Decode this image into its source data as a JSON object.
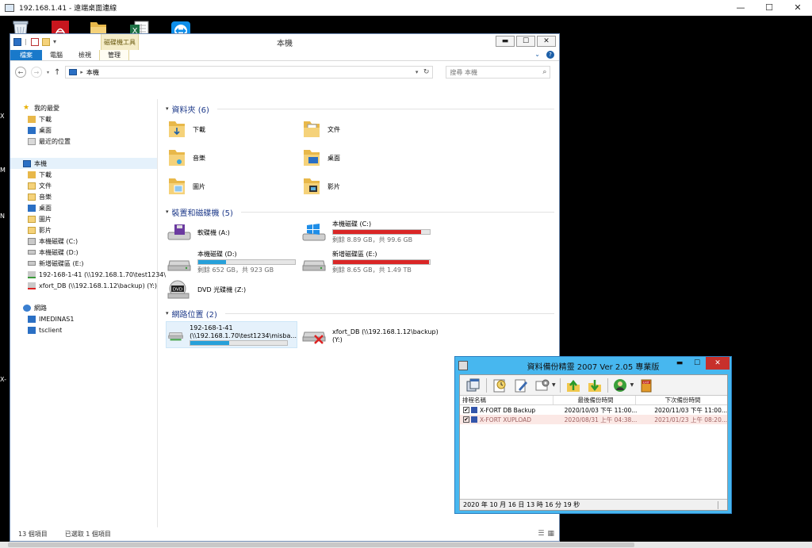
{
  "rdp": {
    "title": "192.168.1.41 - 遠端桌面連線",
    "min": "—",
    "max": "☐",
    "close": "✕"
  },
  "desktop": {
    "icons": [
      {
        "label": "資源回收筒",
        "icon": "recycle-bin-icon"
      },
      {
        "label": "Acrobat",
        "icon": "acrobat-icon"
      },
      {
        "label": "資料夾",
        "icon": "folder-icon"
      },
      {
        "label": "Excel",
        "icon": "excel-icon"
      },
      {
        "label": "TeamViewer",
        "icon": "teamviewer-icon"
      }
    ],
    "left_letters": [
      "X",
      "M",
      "N",
      "X-"
    ]
  },
  "explorer": {
    "title": "本機",
    "context_tab": "磁碟機工具",
    "ribbon_tabs": [
      "檔案",
      "電腦",
      "檢視",
      "管理"
    ],
    "address": "本機",
    "search_placeholder": "搜尋 本機",
    "nav": {
      "favorites_header": "我的最愛",
      "favorites": [
        "下載",
        "桌面",
        "最近的位置"
      ],
      "pc_header": "本機",
      "pc_items": [
        "下載",
        "文件",
        "音樂",
        "桌面",
        "圖片",
        "影片",
        "本機磁碟 (C:)",
        "本機磁碟 (D:)",
        "新增磁碟區 (E:)",
        "192-168-1-41 (\\\\192.168.1.70\\test1234\\",
        "xfort_DB (\\\\192.168.1.12\\backup) (Y:)"
      ],
      "network_header": "網路",
      "network_items": [
        "IMEDINAS1",
        "tsclient"
      ]
    },
    "groups": {
      "folders_header": "資料夾 (6)",
      "folders": [
        "下載",
        "文件",
        "音樂",
        "桌面",
        "圖片",
        "影片"
      ],
      "drives_header": "裝置和磁碟機 (5)",
      "drives": [
        {
          "name": "軟碟機 (A:)",
          "detail": "",
          "fill": 0,
          "color": ""
        },
        {
          "name": "本機磁碟 (C:)",
          "detail": "剩餘 8.89 GB，共 99.6 GB",
          "fill": 0.91,
          "color": "#da2626"
        },
        {
          "name": "本機磁碟 (D:)",
          "detail": "剩餘 652 GB，共 923 GB",
          "fill": 0.29,
          "color": "#26a0da"
        },
        {
          "name": "新增磁碟區 (E:)",
          "detail": "剩餘 8.65 GB，共 1.49 TB",
          "fill": 0.99,
          "color": "#da2626"
        },
        {
          "name": "DVD 光碟機 (Z:)",
          "detail": "",
          "fill": 0,
          "color": ""
        }
      ],
      "network_header": "網路位置 (2)",
      "network": [
        {
          "line1": "192-168-1-41",
          "line2": "(\\\\192.168.1.70\\test1234\\misba...",
          "fill": 0.4,
          "color": "#26a0da"
        },
        {
          "line1": "xfort_DB (\\\\192.168.1.12\\backup)",
          "line2": "(Y:)"
        }
      ]
    },
    "status": {
      "count": "13 個項目",
      "selected": "已選取 1 個項目"
    }
  },
  "backup_app": {
    "title": "資料備份精靈 2007 Ver 2.05 專業版",
    "columns": [
      "排程名稱",
      "最後備份時間",
      "下次備份時間"
    ],
    "rows": [
      {
        "name": "X-FORT DB Backup",
        "last": "2020/10/03 下午 11:00...",
        "next": "2020/11/03 下午 11:00..."
      },
      {
        "name": "X-FORT XUPLOAD",
        "last": "2020/08/31 上午 04:38...",
        "next": "2021/01/23 上午 08:20..."
      }
    ],
    "status": "2020 年 10 月 16 日 13 時 16 分 19 秒"
  }
}
